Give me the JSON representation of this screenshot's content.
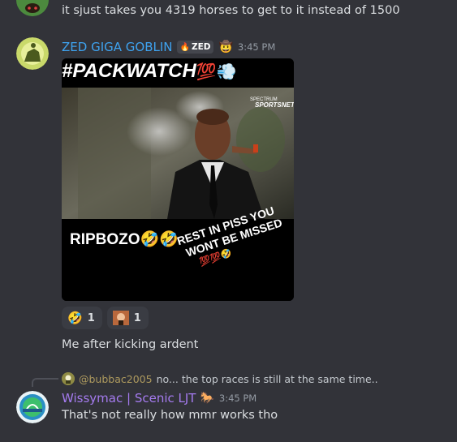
{
  "messages": [
    {
      "text": "it sjust takes you 4319 horses to get to it instead of 1500",
      "avatar_icon": "goblin-avatar-icon"
    },
    {
      "username": "ZED GIGA GOBLIN",
      "username_color": "#3ea3f0",
      "tag_label": "ZED",
      "tag_icon": "flame-icon",
      "badge_icon": "cowboy-emoji-icon",
      "timestamp": "3:45 PM",
      "avatar_icon": "horse-rider-avatar-icon",
      "media": {
        "top_caption": "#PACKWATCH",
        "top_emoji": "💯💨",
        "logo_line1": "SPECTRUM",
        "logo_line2": "SPORTSNET",
        "bottom_left": "RIPBOZO🤣🤣",
        "bottom_right_line1": "REST IN PISS YOU",
        "bottom_right_line2": "WONT BE MISSED",
        "bottom_right_emoji": "💯💯🤣"
      },
      "reactions": [
        {
          "emoji": "🤣",
          "icon": "rofl-emoji-icon",
          "count": "1"
        },
        {
          "emoji": "😱",
          "icon": "custom-face-emoji-icon",
          "count": "1"
        }
      ],
      "text": "Me after kicking ardent"
    },
    {
      "reply": {
        "username": "@bubbac2005",
        "username_color": "#ae9a5e",
        "text": "no... the top races is still at the same time.."
      },
      "username": "Wissymac | Scenic LJT",
      "username_color": "#a57bf0",
      "badge_icon": "horse-emoji-icon",
      "timestamp": "3:45 PM",
      "avatar_icon": "scenic-logo-avatar-icon",
      "text": "That's not really how mmr works tho"
    }
  ]
}
